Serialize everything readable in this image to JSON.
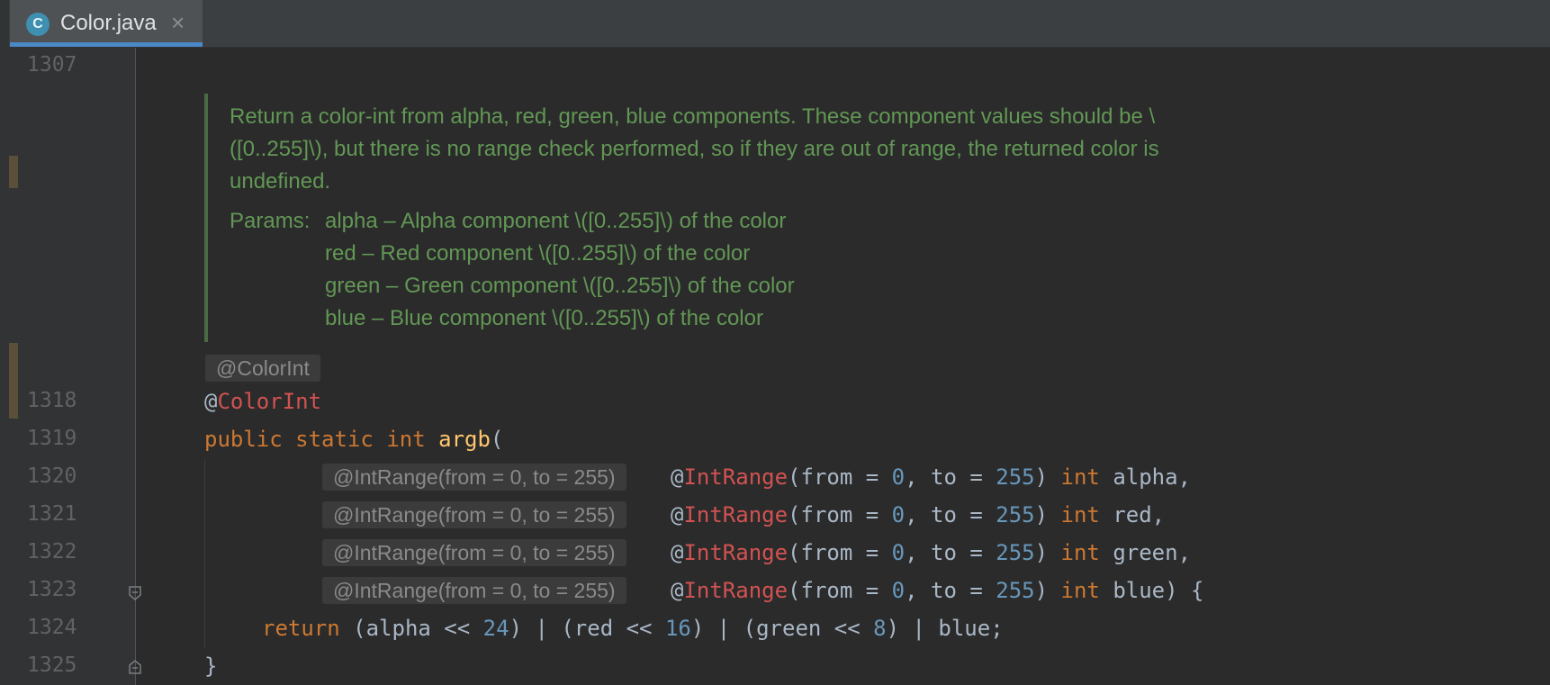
{
  "tab": {
    "icon": "C",
    "title": "Color.java",
    "close": "×"
  },
  "line_numbers": [
    "1307",
    "1318",
    "1319",
    "1320",
    "1321",
    "1322",
    "1323",
    "1324",
    "1325"
  ],
  "doc": {
    "text1": "Return a color-int from alpha, red, green, blue components. These component values should be \\",
    "text2": "([0..255]\\), but there is no range check performed, so if they are out of range, the returned color is",
    "text3": "undefined.",
    "params_label": "Params:",
    "params": [
      "alpha – Alpha component \\([0..255]\\) of the color",
      "red – Red component \\([0..255]\\) of the color",
      "green – Green component \\([0..255]\\) of the color",
      "blue – Blue component \\([0..255]\\) of the color"
    ]
  },
  "hints": {
    "colorint": "@ColorInt",
    "intrange": "@IntRange(from = 0, to = 255)"
  },
  "code": {
    "at": "@",
    "colorint": "ColorInt",
    "public": "public",
    "static": "static",
    "int": "int",
    "method": "argb",
    "paren_open": "(",
    "intrange": "IntRange",
    "from_part": "(from = ",
    "zero": "0",
    "to_part": ", to = ",
    "max": "255",
    "close_part": ") ",
    "params": [
      "alpha,",
      "red,",
      "green,",
      "blue) {"
    ],
    "return": "return",
    "ret_a": " (alpha << ",
    "n24": "24",
    "ret_b": ") | (red << ",
    "n16": "16",
    "ret_c": ") | (green << ",
    "n8": "8",
    "ret_d": ") | blue;",
    "close_brace": "}"
  }
}
